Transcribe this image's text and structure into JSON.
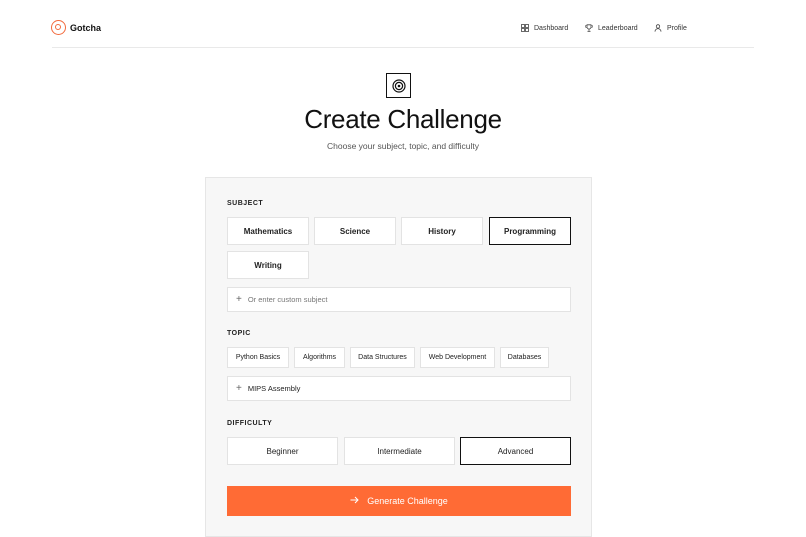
{
  "header": {
    "brand": "Gotcha",
    "nav": [
      {
        "label": "Dashboard",
        "icon": "grid-icon"
      },
      {
        "label": "Leaderboard",
        "icon": "trophy-icon"
      },
      {
        "label": "Profile",
        "icon": "user-icon"
      }
    ]
  },
  "hero": {
    "icon": "target-icon",
    "title": "Create Challenge",
    "subtitle": "Choose your subject, topic, and difficulty"
  },
  "subject": {
    "label": "SUBJECT",
    "options": [
      "Mathematics",
      "Science",
      "History",
      "Programming",
      "Writing"
    ],
    "selected": "Programming",
    "custom_placeholder": "Or enter custom subject"
  },
  "topic": {
    "label": "TOPIC",
    "chips": [
      "Python Basics",
      "Algorithms",
      "Data Structures",
      "Web Development",
      "Databases"
    ],
    "custom_value": "MIPS Assembly"
  },
  "difficulty": {
    "label": "DIFFICULTY",
    "options": [
      "Beginner",
      "Intermediate",
      "Advanced"
    ],
    "selected": "Advanced"
  },
  "action": {
    "generate_label": "Generate Challenge",
    "icon": "arrow-right-icon"
  },
  "colors": {
    "accent": "#ff6b35",
    "brand": "#f26a3d",
    "card_bg": "#f7f7f7"
  }
}
